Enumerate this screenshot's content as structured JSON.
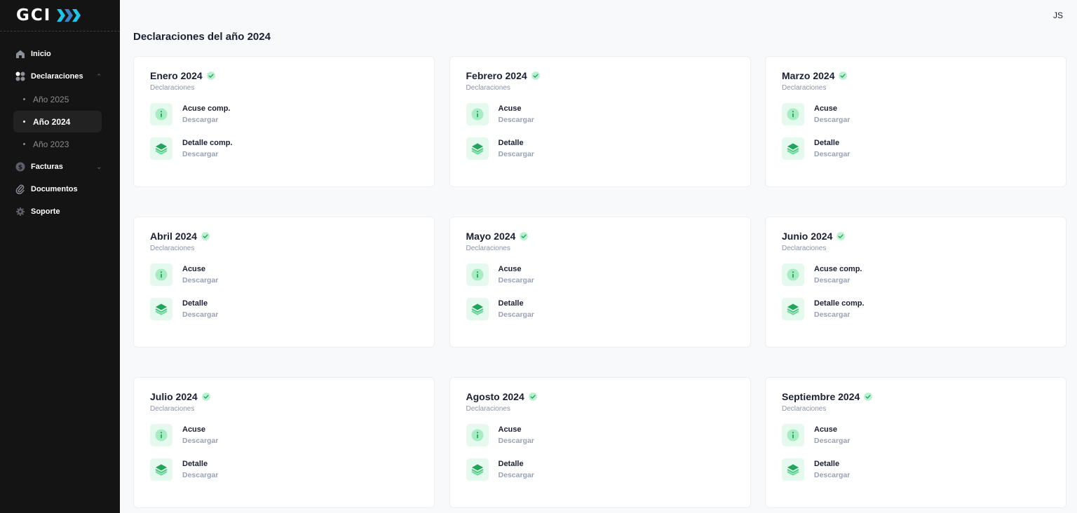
{
  "brand": {
    "name": "GCI",
    "accent": "#22c3e6"
  },
  "user": {
    "initials": "JS"
  },
  "sidebar": {
    "items": [
      {
        "label": "Inicio",
        "icon": "home-icon"
      },
      {
        "label": "Declaraciones",
        "icon": "apps-icon"
      },
      {
        "label": "Facturas",
        "icon": "dollar-icon"
      },
      {
        "label": "Documentos",
        "icon": "paperclip-icon"
      },
      {
        "label": "Soporte",
        "icon": "gear-icon"
      }
    ],
    "declaraciones_sub": [
      {
        "label": "Año 2025",
        "active": false
      },
      {
        "label": "Año 2024",
        "active": true
      },
      {
        "label": "Año 2023",
        "active": false
      }
    ]
  },
  "page": {
    "title": "Declaraciones del año 2024"
  },
  "colors": {
    "green": "#4ade80",
    "green_bg": "#e6f9ee",
    "text": "#1b2033",
    "muted": "#98a2b3"
  },
  "cards": [
    {
      "title": "Enero 2024",
      "subtitle": "Declaraciones",
      "acuse": "Acuse comp.",
      "acuse_action": "Descargar",
      "detalle": "Detalle comp.",
      "detalle_action": "Descargar"
    },
    {
      "title": "Febrero 2024",
      "subtitle": "Declaraciones",
      "acuse": "Acuse",
      "acuse_action": "Descargar",
      "detalle": "Detalle",
      "detalle_action": "Descargar"
    },
    {
      "title": "Marzo 2024",
      "subtitle": "Declaraciones",
      "acuse": "Acuse",
      "acuse_action": "Descargar",
      "detalle": "Detalle",
      "detalle_action": "Descargar"
    },
    {
      "title": "Abril 2024",
      "subtitle": "Declaraciones",
      "acuse": "Acuse",
      "acuse_action": "Descargar",
      "detalle": "Detalle",
      "detalle_action": "Descargar"
    },
    {
      "title": "Mayo 2024",
      "subtitle": "Declaraciones",
      "acuse": "Acuse",
      "acuse_action": "Descargar",
      "detalle": "Detalle",
      "detalle_action": "Descargar"
    },
    {
      "title": "Junio 2024",
      "subtitle": "Declaraciones",
      "acuse": "Acuse comp.",
      "acuse_action": "Descargar",
      "detalle": "Detalle comp.",
      "detalle_action": "Descargar"
    },
    {
      "title": "Julio 2024",
      "subtitle": "Declaraciones",
      "acuse": "Acuse",
      "acuse_action": "Descargar",
      "detalle": "Detalle",
      "detalle_action": "Descargar"
    },
    {
      "title": "Agosto 2024",
      "subtitle": "Declaraciones",
      "acuse": "Acuse",
      "acuse_action": "Descargar",
      "detalle": "Detalle",
      "detalle_action": "Descargar"
    },
    {
      "title": "Septiembre 2024",
      "subtitle": "Declaraciones",
      "acuse": "Acuse",
      "acuse_action": "Descargar",
      "detalle": "Detalle",
      "detalle_action": "Descargar"
    }
  ]
}
